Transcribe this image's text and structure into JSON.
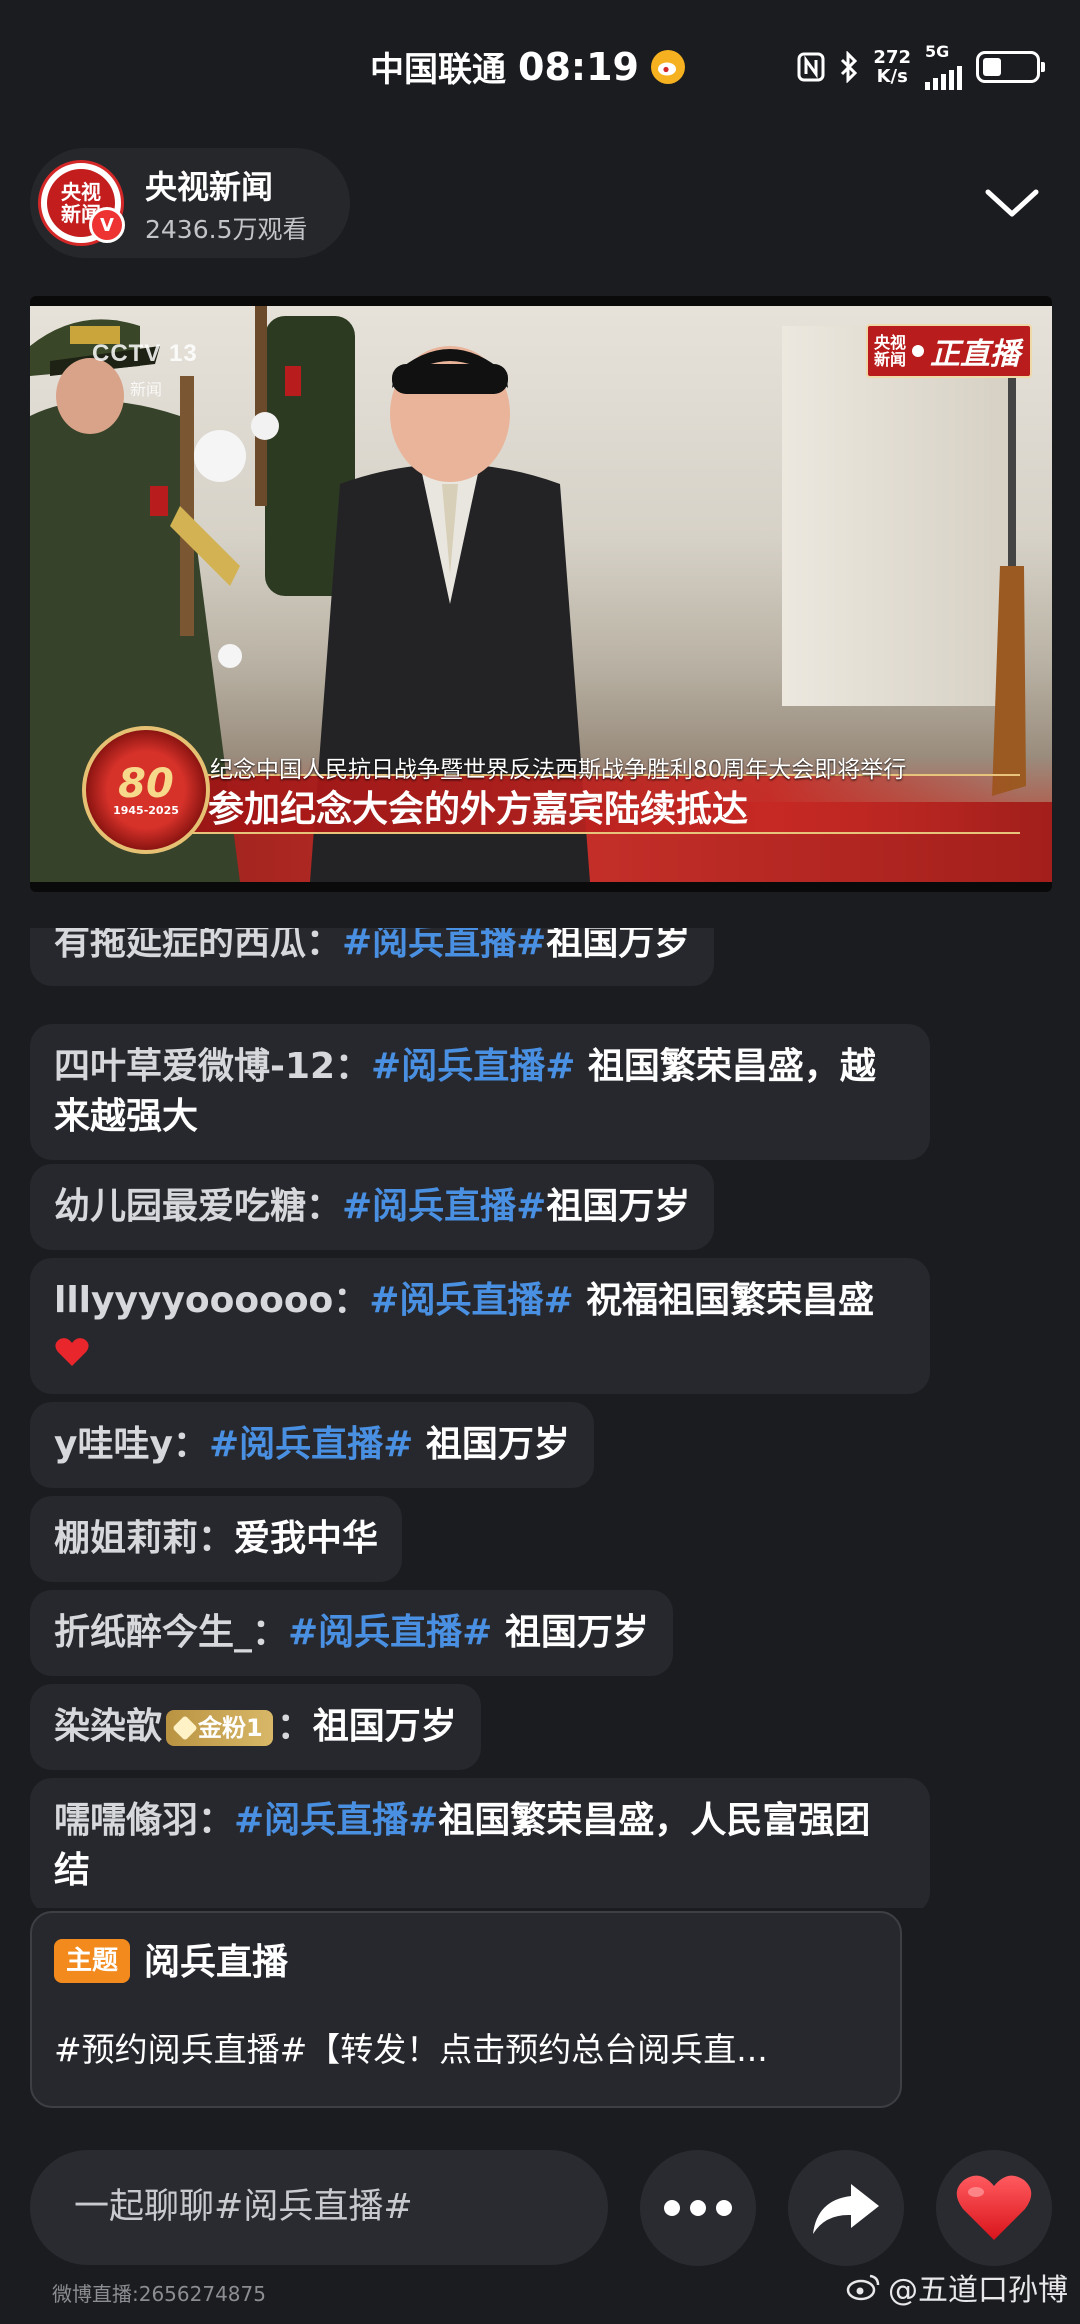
{
  "status_bar": {
    "carrier": "中国联通",
    "time": "08:19",
    "net_speed_value": "272",
    "net_speed_unit": "K/s",
    "network": "5G",
    "battery_level": 0.35
  },
  "header": {
    "channel_name": "央视新闻",
    "views": "2436.5万观看",
    "avatar_text_top": "央视",
    "avatar_text_bottom": "新闻",
    "verified_mark": "V"
  },
  "video": {
    "channel_logo": "CCTV 13",
    "channel_logo_sub": "新闻",
    "live_logo_top": "央视",
    "live_logo_bottom": "新闻",
    "live_label": "正直播",
    "ticker_small": "纪念中国人民抗日战争暨世界反法西斯战争胜利80周年大会即将举行",
    "ticker_big": "参加纪念大会的外方嘉宾陆续抵达",
    "emblem_number": "80",
    "emblem_years": "1945-2025"
  },
  "comments": [
    {
      "user": "有拖延症的西瓜：",
      "tag": "#阅兵直播#",
      "text": "祖国万岁"
    },
    {
      "user": "四叶草爱微博-12：",
      "tag": "#阅兵直播#",
      "text": " 祖国繁荣昌盛，越来越强大"
    },
    {
      "user": "幼儿园最爱吃糖：",
      "tag": "#阅兵直播#",
      "text": "祖国万岁"
    },
    {
      "user": "lllyyyyoooooo：",
      "tag": "#阅兵直播#",
      "text": " 祝福祖国繁荣昌盛"
    },
    {
      "user": "y哇哇y：",
      "tag": "#阅兵直播#",
      "text": " 祖国万岁"
    },
    {
      "user": "棚姐莉莉：",
      "tag": "",
      "text": "爱我中华"
    },
    {
      "user": "折纸醉今生_：",
      "tag": "#阅兵直播#",
      "text": " 祖国万岁"
    },
    {
      "user": "染染歆",
      "badge": "金粉1",
      "user_suffix": "：",
      "tag": "",
      "text": "祖国万岁"
    },
    {
      "user": "嚅嚅翛羽：",
      "tag": "#阅兵直播#",
      "text": "祖国繁荣昌盛，人民富强团结"
    }
  ],
  "topic": {
    "badge": "主题",
    "title": "阅兵直播",
    "description": "#预约阅兵直播#【转发！点击预约总台阅兵直..."
  },
  "bottom_bar": {
    "chat_placeholder": "一起聊聊#阅兵直播#",
    "more_icon": "more-dots-icon",
    "share_icon": "share-arrow-icon",
    "like_icon": "heart-icon"
  },
  "footer": {
    "live_id": "微博直播:2656274875",
    "watermark": "@五道口孙博"
  },
  "colors": {
    "background": "#1b1c20",
    "hashtag": "#4a90e2",
    "topic_badge": "#f28a1d",
    "like_heart": "#e8262b"
  }
}
